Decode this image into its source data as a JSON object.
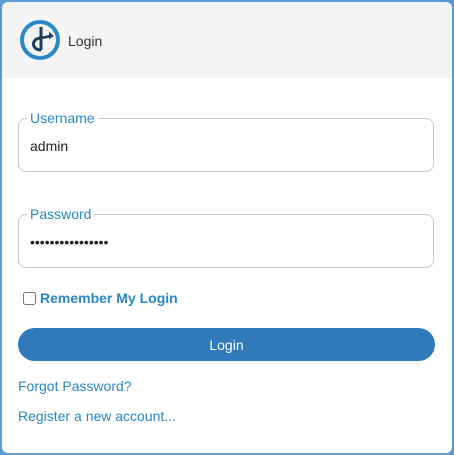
{
  "header": {
    "logo_icon": "logo-icon",
    "title": "Login"
  },
  "form": {
    "username": {
      "label": "Username",
      "value": "admin"
    },
    "password": {
      "label": "Password",
      "value": "••••••••••••••••"
    },
    "remember": {
      "label": "Remember My Login",
      "checked": false
    },
    "login_button": "Login"
  },
  "links": {
    "forgot_password": "Forgot Password?",
    "register": "Register a new account..."
  },
  "colors": {
    "accent": "#2a87c8",
    "button": "#3079bb",
    "header_bg": "#f4f4f4",
    "outer_border": "#5b9bd5"
  }
}
